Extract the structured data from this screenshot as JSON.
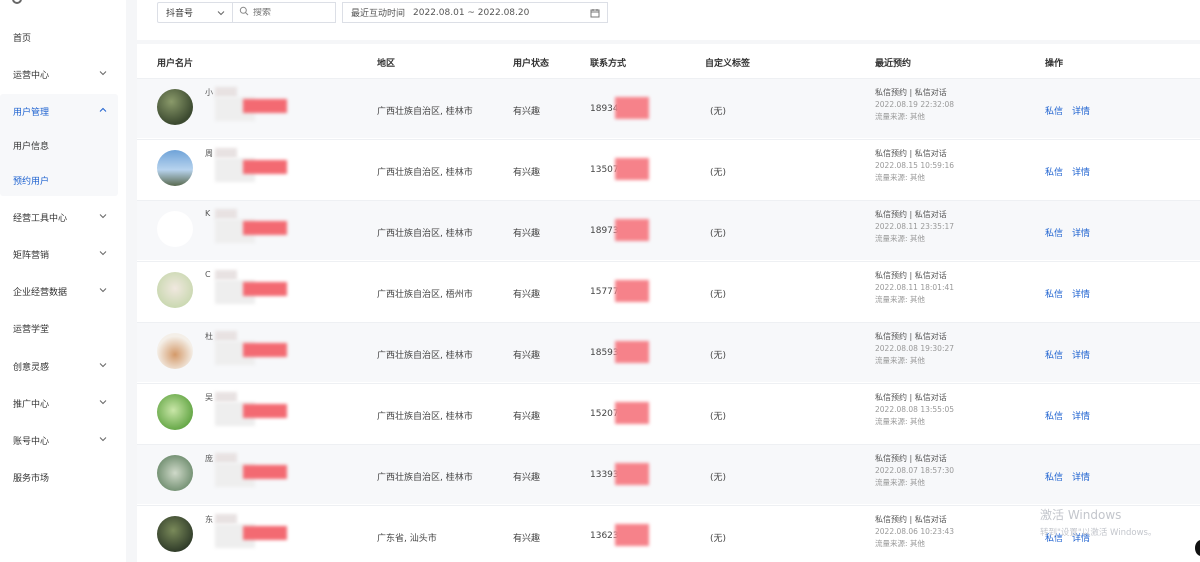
{
  "sidebar": {
    "items": [
      {
        "label": "首页",
        "chevron": false
      },
      {
        "label": "运营中心",
        "chevron": true
      },
      {
        "label": "用户管理",
        "chevron": true,
        "expanded": true
      },
      {
        "label": "用户信息",
        "chevron": false,
        "child": true
      },
      {
        "label": "预约用户",
        "chevron": false,
        "child": true,
        "active": true
      },
      {
        "label": "经营工具中心",
        "chevron": true
      },
      {
        "label": "矩阵营销",
        "chevron": true
      },
      {
        "label": "企业经营数据",
        "chevron": true
      },
      {
        "label": "运营学堂",
        "chevron": false
      },
      {
        "label": "创意灵感",
        "chevron": true
      },
      {
        "label": "推广中心",
        "chevron": true
      },
      {
        "label": "账号中心",
        "chevron": true
      },
      {
        "label": "服务市场",
        "chevron": false
      }
    ]
  },
  "filters": {
    "account_select": "抖音号",
    "search_placeholder": "搜索",
    "date_label": "最近互动时间",
    "date_range": "2022.08.01 ~ 2022.08.20"
  },
  "table": {
    "headers": {
      "name": "用户名片",
      "region": "地区",
      "status": "用户状态",
      "contact": "联系方式",
      "tags": "自定义标签",
      "booking": "最近预约",
      "ops": "操作"
    },
    "rows": [
      {
        "name_initial": "小",
        "region": "广西壮族自治区, 桂林市",
        "status": "有兴趣",
        "phone_prefix": "18934",
        "tags": "(无)",
        "booking_type": "私信预约 | 私信对话",
        "booking_time": "2022.08.19 22:32:08",
        "source": "流量来源: 其他",
        "op_msg": "私信",
        "op_detail": "详情"
      },
      {
        "name_initial": "周",
        "region": "广西壮族自治区, 桂林市",
        "status": "有兴趣",
        "phone_prefix": "13507",
        "tags": "(无)",
        "booking_type": "私信预约 | 私信对话",
        "booking_time": "2022.08.15 10:59:16",
        "source": "流量来源: 其他",
        "op_msg": "私信",
        "op_detail": "详情"
      },
      {
        "name_initial": "K",
        "region": "广西壮族自治区, 桂林市",
        "status": "有兴趣",
        "phone_prefix": "18973",
        "tags": "(无)",
        "booking_type": "私信预约 | 私信对话",
        "booking_time": "2022.08.11 23:35:17",
        "source": "流量来源: 其他",
        "op_msg": "私信",
        "op_detail": "详情"
      },
      {
        "name_initial": "C",
        "region": "广西壮族自治区, 梧州市",
        "status": "有兴趣",
        "phone_prefix": "15777",
        "tags": "(无)",
        "booking_type": "私信预约 | 私信对话",
        "booking_time": "2022.08.11 18:01:41",
        "source": "流量来源: 其他",
        "op_msg": "私信",
        "op_detail": "详情"
      },
      {
        "name_initial": "杜",
        "region": "广西壮族自治区, 桂林市",
        "status": "有兴趣",
        "phone_prefix": "18593",
        "tags": "(无)",
        "booking_type": "私信预约 | 私信对话",
        "booking_time": "2022.08.08 19:30:27",
        "source": "流量来源: 其他",
        "op_msg": "私信",
        "op_detail": "详情"
      },
      {
        "name_initial": "吴",
        "region": "广西壮族自治区, 桂林市",
        "status": "有兴趣",
        "phone_prefix": "15207",
        "tags": "(无)",
        "booking_type": "私信预约 | 私信对话",
        "booking_time": "2022.08.08 13:55:05",
        "source": "流量来源: 其他",
        "op_msg": "私信",
        "op_detail": "详情"
      },
      {
        "name_initial": "庞",
        "region": "广西壮族自治区, 桂林市",
        "status": "有兴趣",
        "phone_prefix": "13393",
        "tags": "(无)",
        "booking_type": "私信预约 | 私信对话",
        "booking_time": "2022.08.07 18:57:30",
        "source": "流量来源: 其他",
        "op_msg": "私信",
        "op_detail": "详情"
      },
      {
        "name_initial": "东",
        "region": "广东省, 汕头市",
        "status": "有兴趣",
        "phone_prefix": "13623",
        "tags": "(无)",
        "booking_type": "私信预约 | 私信对话",
        "booking_time": "2022.08.06 10:23:43",
        "source": "流量来源: 其他",
        "op_msg": "私信",
        "op_detail": "详情"
      }
    ]
  },
  "watermark": {
    "line1": "激活 Windows",
    "line2": "转到\"设置\"以激活 Windows。"
  },
  "colors": {
    "accent": "#1e62d0",
    "redaction": "#f0505a"
  }
}
